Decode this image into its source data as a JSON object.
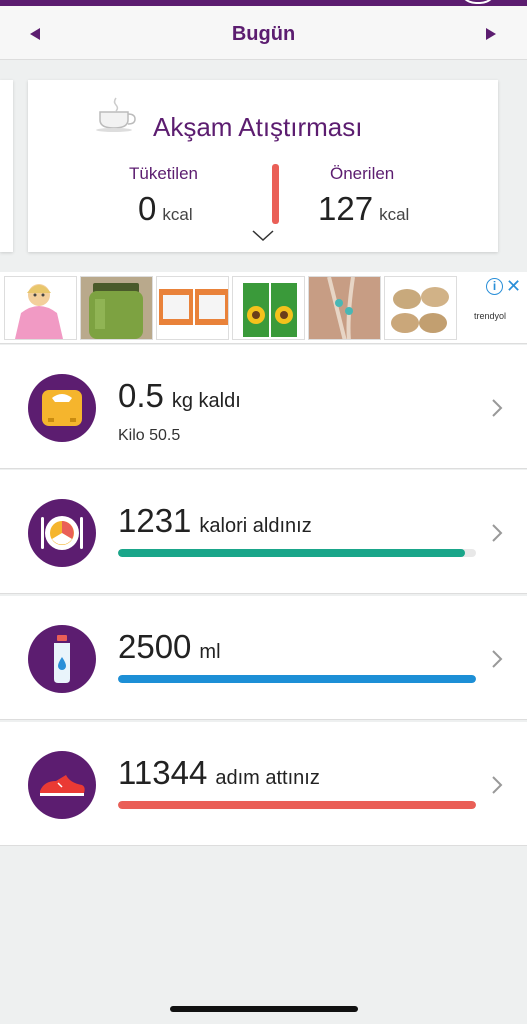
{
  "header": {
    "title": "Bugün",
    "accent": "#5c1d70"
  },
  "meal": {
    "title": "Akşam Atıştırması",
    "consumed_label": "Tüketilen",
    "consumed_value": "0",
    "consumed_unit": "kcal",
    "recommended_label": "Önerilen",
    "recommended_value": "127",
    "recommended_unit": "kcal"
  },
  "ad": {
    "brand": "trendyol"
  },
  "rows": [
    {
      "icon": "scale-icon",
      "value": "0.5",
      "suffix": "kg kaldı",
      "sub": "Kilo 50.5"
    },
    {
      "icon": "plate-icon",
      "value": "1231",
      "suffix": "kalori aldınız",
      "progress": 0.97,
      "color": "#1aa68a"
    },
    {
      "icon": "water-bottle-icon",
      "value": "2500",
      "suffix": "ml",
      "progress": 1.0,
      "color": "#1d8fd6"
    },
    {
      "icon": "sneaker-icon",
      "value": "11344",
      "suffix": "adım attınız",
      "progress": 1.0,
      "color": "#ea5f57"
    }
  ]
}
